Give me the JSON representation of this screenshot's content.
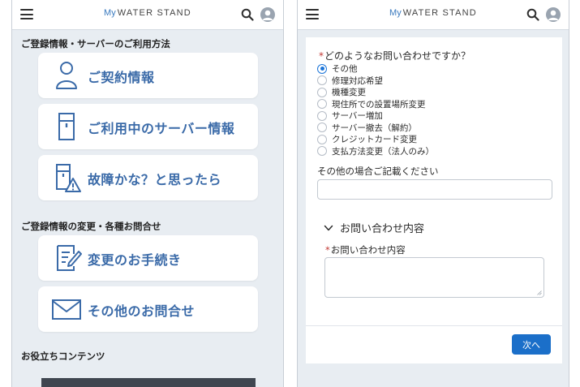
{
  "brand": {
    "prefix": "My",
    "name": "WATER STAND"
  },
  "left_screen": {
    "section1_heading": "ご登録情報・サーバーのご利用方法",
    "section1_items": [
      {
        "label": "ご契約情報",
        "icon": "person-icon"
      },
      {
        "label": "ご利用中のサーバー情報",
        "icon": "water-server-icon"
      },
      {
        "label": "故障かな？と思ったら",
        "icon": "server-warning-icon"
      }
    ],
    "section2_heading": "ご登録情報の変更・各種お問合せ",
    "section2_items": [
      {
        "label": "変更のお手続き",
        "icon": "edit-document-icon"
      },
      {
        "label": "その他のお問合せ",
        "icon": "envelope-icon"
      }
    ],
    "section3_heading": "お役立ちコンテンツ"
  },
  "right_screen": {
    "question_label": "どのようなお問い合わせですか？",
    "options": [
      {
        "label": "その他",
        "selected": true
      },
      {
        "label": "修理対応希望",
        "selected": false
      },
      {
        "label": "機種変更",
        "selected": false
      },
      {
        "label": "現住所での設置場所変更",
        "selected": false
      },
      {
        "label": "サーバー増加",
        "selected": false
      },
      {
        "label": "サーバー撤去（解約）",
        "selected": false
      },
      {
        "label": "クレジットカード変更",
        "selected": false
      },
      {
        "label": "支払方法変更（法人のみ）",
        "selected": false
      }
    ],
    "other_label": "その他の場合ご記載ください",
    "other_value": "",
    "section_title": "お問い合わせ内容",
    "inquiry_label": "お問い合わせ内容",
    "inquiry_value": "",
    "next_button": "次へ"
  },
  "colors": {
    "accent": "#3a6aa8",
    "primary_button": "#1b6fc9",
    "required": "#c23934",
    "background": "#e8edf2"
  }
}
